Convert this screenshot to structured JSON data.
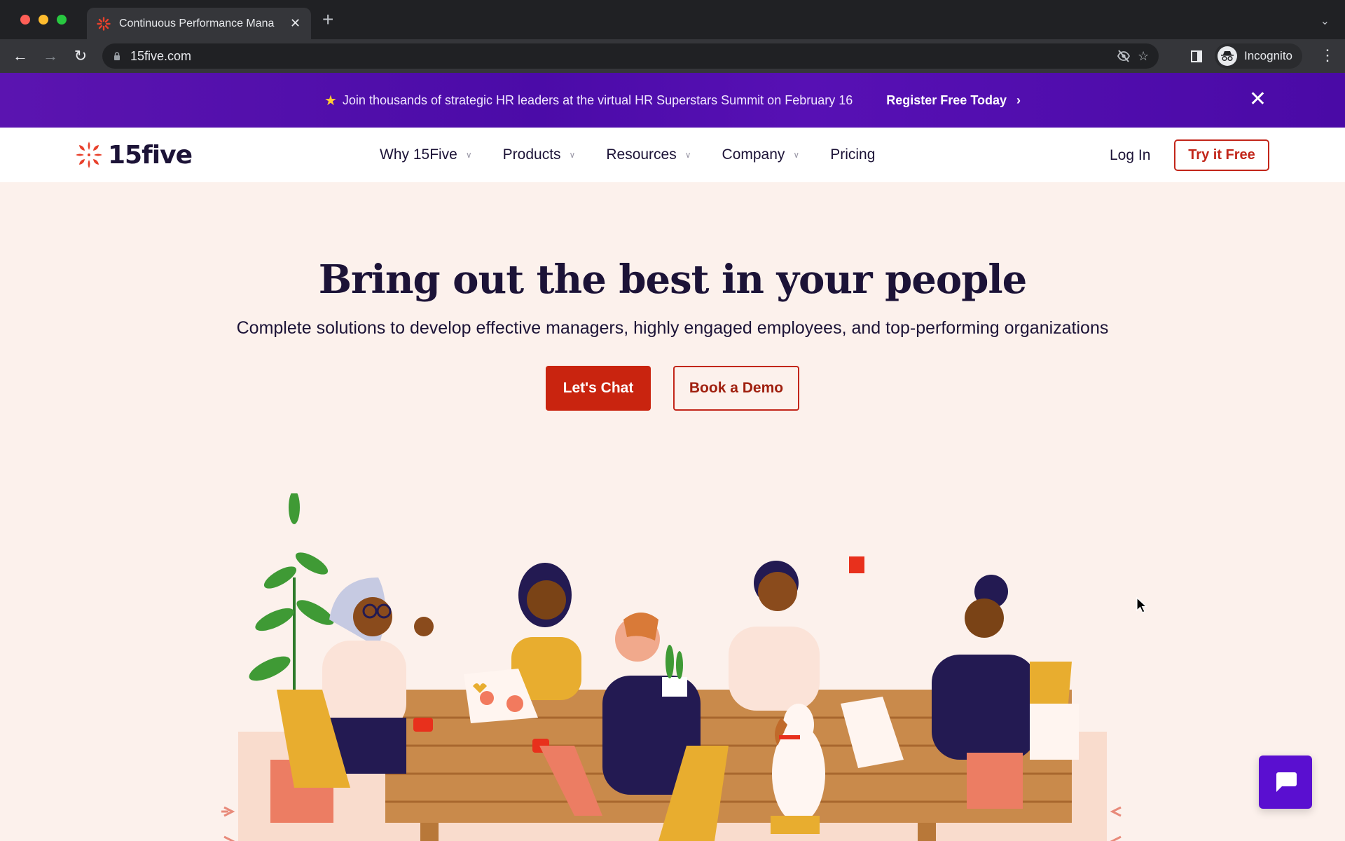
{
  "browser": {
    "tab_title": "Continuous Performance Mana",
    "url": "15five.com",
    "profile_label": "Incognito",
    "icons": [
      "back-icon",
      "forward-icon",
      "reload-icon",
      "lock-icon",
      "eye-off-icon",
      "star-icon",
      "side-panel-icon",
      "incognito-icon",
      "more-icon",
      "new-tab-icon",
      "tab-search-icon"
    ]
  },
  "promo": {
    "star_icon": "★",
    "text": "Join thousands of strategic HR leaders at the virtual HR Superstars Summit on February 16",
    "link_label": "Register Free Today",
    "chevron": "›",
    "close": "✕"
  },
  "nav": {
    "logo_text": "15five",
    "items": [
      {
        "label": "Why 15Five",
        "has_dropdown": true
      },
      {
        "label": "Products",
        "has_dropdown": true
      },
      {
        "label": "Resources",
        "has_dropdown": true
      },
      {
        "label": "Company",
        "has_dropdown": true
      },
      {
        "label": "Pricing",
        "has_dropdown": false
      }
    ],
    "login_label": "Log In",
    "cta_label": "Try it Free"
  },
  "hero": {
    "title": "Bring out the best in your people",
    "subtitle": "Complete solutions to develop effective managers, highly engaged employees, and top-performing organizations",
    "primary_cta": "Let's Chat",
    "secondary_cta": "Book a Demo",
    "illustration_alt": "People collaborating around a wooden table with a dog"
  },
  "colors": {
    "brand_red": "#c9240f",
    "brand_purple": "#5a0fd0",
    "text_dark": "#1c1337",
    "page_bg": "#fcf1ec"
  }
}
